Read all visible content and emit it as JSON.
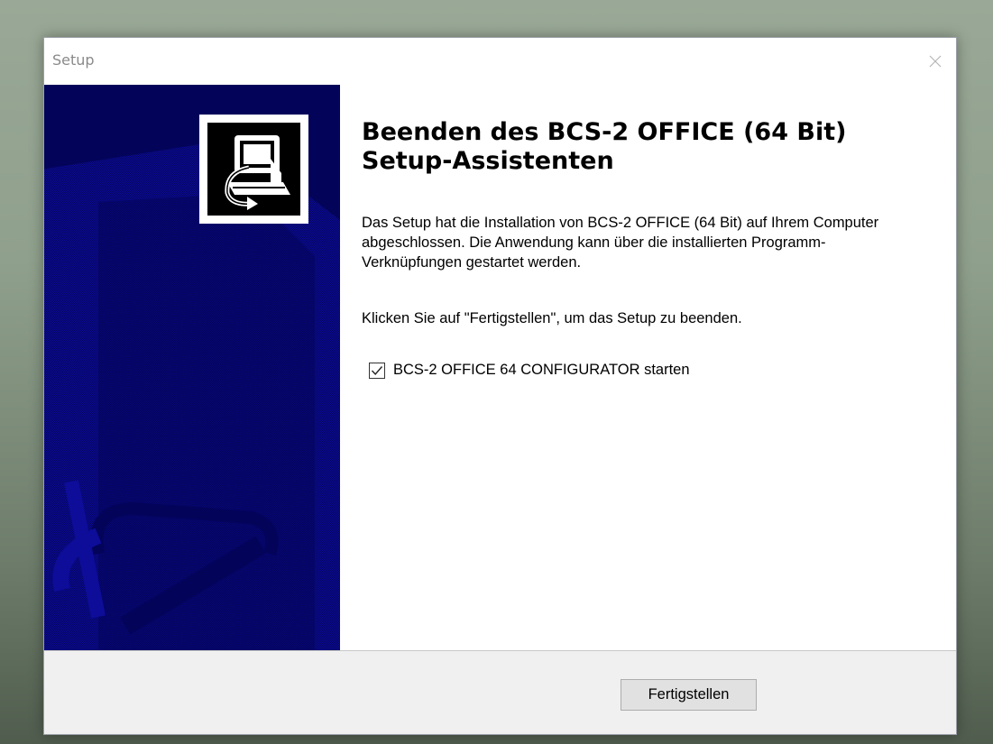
{
  "window": {
    "title": "Setup"
  },
  "main": {
    "heading": "Beenden des BCS-2 OFFICE (64 Bit) Setup-Assistenten",
    "paragraph1": "Das Setup hat die Installation von BCS-2 OFFICE (64 Bit) auf Ihrem Computer abgeschlossen. Die Anwendung kann über die installierten Programm-Verknüpfungen gestartet werden.",
    "paragraph2": "Klicken Sie auf \"Fertigstellen\", um das Setup zu beenden.",
    "checkbox": {
      "label": "BCS-2 OFFICE 64 CONFIGURATOR starten",
      "checked": true
    }
  },
  "footer": {
    "finish_label": "Fertigstellen"
  },
  "colors": {
    "side_panel": "#03035a",
    "footer": "#f0f0f0"
  },
  "icons": {
    "close": "close-icon",
    "checkbox": "checkmark-icon",
    "installer": "computer-install-icon"
  }
}
